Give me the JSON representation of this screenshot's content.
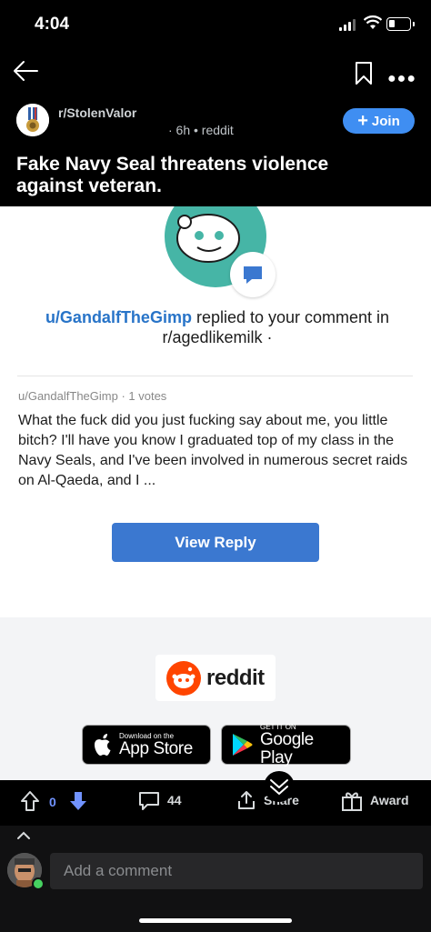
{
  "status_bar": {
    "time": "4:04"
  },
  "post": {
    "subreddit": "r/StolenValor",
    "meta": "· 6h • reddit",
    "join_label": "Join",
    "title": "Fake Navy Seal threatens violence against veteran."
  },
  "email": {
    "reply_user": "u/GandalfTheGimp",
    "reply_text": " replied to your comment in",
    "reply_subreddit": "r/agedlikemilk ·",
    "comment_meta": "u/GandalfTheGimp · 1 votes",
    "comment_body": "What the fuck did you just fucking say about me, you little bitch? I'll have you know I graduated top of my class in the Navy Seals, and I've been involved in numerous secret raids on Al-Qaeda, and I ...",
    "view_reply_label": "View Reply",
    "logo_word": "reddit",
    "app_store": {
      "small": "Download on the",
      "big": "App Store"
    },
    "google_play": {
      "small": "GET IT ON",
      "big": "Google Play"
    }
  },
  "actions": {
    "vote_count": "0",
    "comments_count": "44",
    "share_label": "Share",
    "award_label": "Award"
  },
  "composer": {
    "placeholder": "Add a comment"
  },
  "colors": {
    "accent": "#3f8ef2",
    "downvote": "#7193ff",
    "link": "#2874c8",
    "button": "#3b78d0"
  },
  "icons": [
    "back-arrow-icon",
    "bookmark-icon",
    "more-icon",
    "plus-icon",
    "upvote-icon",
    "downvote-icon",
    "comment-icon",
    "share-icon",
    "award-icon",
    "chevron-up-icon",
    "chevron-down-icon"
  ]
}
